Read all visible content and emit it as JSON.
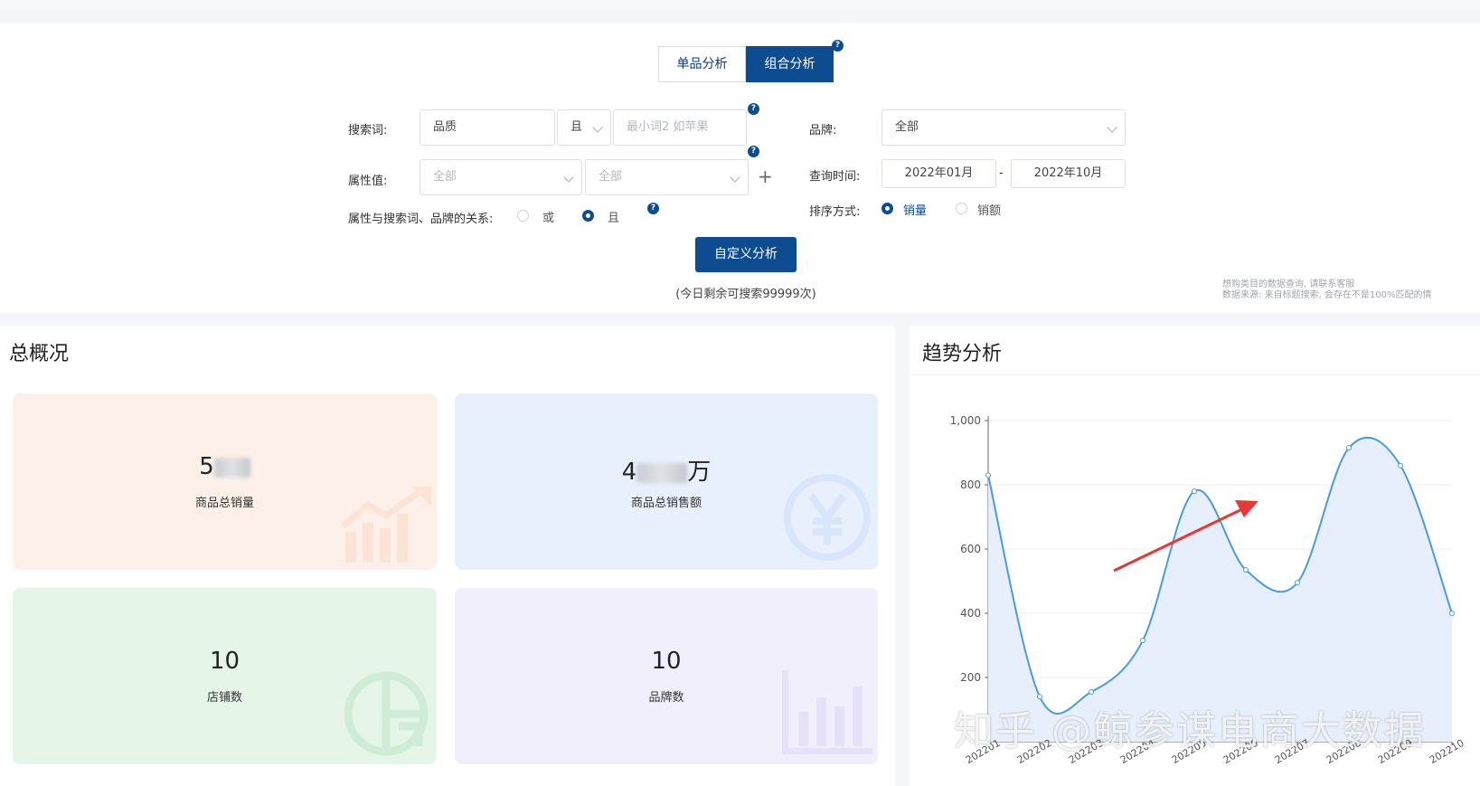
{
  "tabs": {
    "single": "单品分析",
    "combo": "组合分析"
  },
  "filters": {
    "search_label": "搜索词:",
    "search_value": "品质",
    "logic_value": "且",
    "search2_placeholder": "最小词2 如苹果",
    "attr_label": "属性值:",
    "attr1": "全部",
    "attr2": "全部",
    "add_symbol": "+",
    "relation_label": "属性与搜索词、品牌的关系:",
    "relation_or": "或",
    "relation_and": "且",
    "brand_label": "品牌:",
    "brand_value": "全部",
    "time_label": "查询时间:",
    "time_start": "2022年01月",
    "time_sep": "-",
    "time_end": "2022年10月",
    "sort_label": "排序方式:",
    "sort_volume": "销量",
    "sort_amount": "销额"
  },
  "analyze_button": "自定义分析",
  "remaining": "(今日剩余可搜索99999次)",
  "note_line1": "想购类目的数据查询, 请联系客服",
  "note_line2": "数据来源: 来自标题搜索, 会存在不是100%匹配的情",
  "overview": {
    "title": "总概况",
    "cards": [
      {
        "value_prefix": "5",
        "label": "商品总销量"
      },
      {
        "value_prefix": "4",
        "value_suffix": "万",
        "label": "商品总销售额"
      },
      {
        "value": "10",
        "label": "店铺数"
      },
      {
        "value": "10",
        "label": "品牌数"
      }
    ]
  },
  "trend": {
    "title": "趋势分析"
  },
  "watermark": "知乎 @鲸参谋电商大数据",
  "colors": {
    "primary": "#0d4c91",
    "line": "#4a9be0",
    "arrow": "#e53935"
  },
  "chart_data": {
    "type": "area",
    "x": [
      "202201",
      "202202",
      "202203",
      "202204",
      "202205",
      "202206",
      "202207",
      "202208",
      "202209",
      "202210"
    ],
    "series": [
      {
        "values": [
          830,
          140,
          155,
          315,
          780,
          535,
          495,
          915,
          860,
          400
        ]
      }
    ],
    "yticks": [
      "200",
      "400",
      "600",
      "800",
      "1,000"
    ],
    "ylim": [
      0,
      1000
    ],
    "grid": true
  }
}
